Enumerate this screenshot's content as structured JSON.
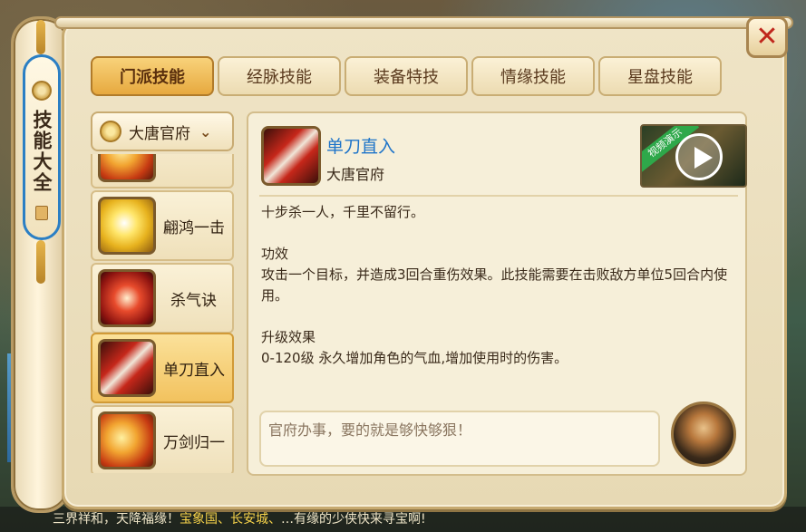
{
  "scroll": {
    "title": "技能大全"
  },
  "tabs": [
    {
      "label": "门派技能",
      "active": true
    },
    {
      "label": "经脉技能",
      "active": false
    },
    {
      "label": "装备特技",
      "active": false
    },
    {
      "label": "情缘技能",
      "active": false
    },
    {
      "label": "星盘技能",
      "active": false
    }
  ],
  "school_select": {
    "value": "大唐官府"
  },
  "skills": [
    {
      "name": "翩鸿一击",
      "icon": "gold-sword-icon"
    },
    {
      "name": "杀气诀",
      "icon": "red-aura-icon"
    },
    {
      "name": "单刀直入",
      "icon": "blade-icon",
      "active": true
    },
    {
      "name": "万剑归一",
      "icon": "fire-swords-icon"
    }
  ],
  "detail": {
    "title": "单刀直入",
    "school": "大唐官府",
    "video_label": "视频演示",
    "intro": "十步杀一人，千里不留行。",
    "effect_heading": "功效",
    "effect_text": "攻击一个目标，并造成3回合重伤效果。此技能需要在击败敌方单位5回合内使用。",
    "upgrade_heading": "升级效果",
    "upgrade_text": "0-120级 永久增加角色的气血,增加使用时的伤害。",
    "quote": "官府办事，要的就是够快够狠！"
  },
  "marquee": {
    "prefix": "三界祥和，天降福缘！",
    "highlight": "宝象国、长安城、",
    "suffix": "有缘的少侠快来寻宝啊!"
  }
}
